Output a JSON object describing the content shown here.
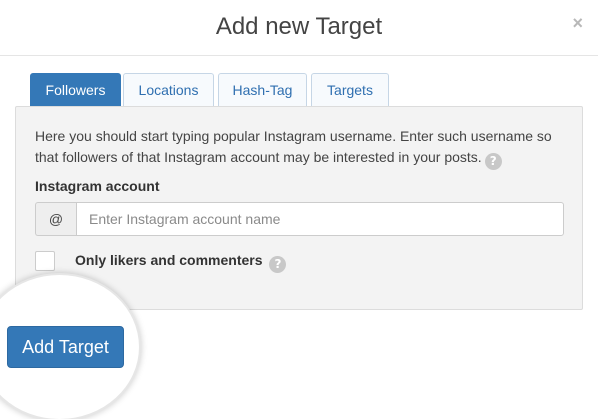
{
  "modal": {
    "title": "Add new Target",
    "close_label": "×"
  },
  "tabs": [
    {
      "label": "Followers",
      "active": true
    },
    {
      "label": "Locations",
      "active": false
    },
    {
      "label": "Hash-Tag",
      "active": false
    },
    {
      "label": "Targets",
      "active": false
    }
  ],
  "followers_panel": {
    "description": "Here you should start typing popular Instagram username. Enter such username so that followers of that Instagram account may be interested in your posts.",
    "help_icon": "?",
    "account_label": "Instagram account",
    "input_prefix": "@",
    "input_value": "",
    "input_placeholder": "Enter Instagram account name",
    "checkbox_checked": false,
    "checkbox_label": "Only likers and commenters",
    "checkbox_help_icon": "?"
  },
  "footer": {
    "add_button_label": "Add Target"
  },
  "colors": {
    "primary": "#3478b7",
    "panel_bg": "#f3f3f3",
    "help_icon_bg": "#c8c8c8"
  }
}
